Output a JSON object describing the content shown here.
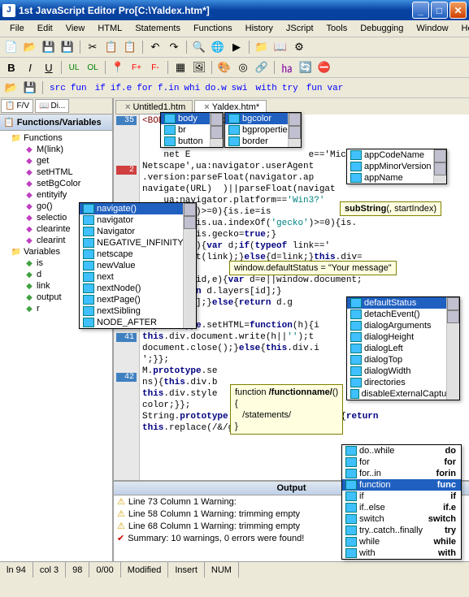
{
  "title": "1st JavaScript Editor Pro[C:\\Yaldex.htm*]",
  "menu": [
    "File",
    "Edit",
    "View",
    "HTML",
    "Statements",
    "Functions",
    "History",
    "JScript",
    "Tools",
    "Debugging",
    "Window",
    "Help"
  ],
  "toolbar3": {
    "items": [
      "src",
      "fun",
      "if",
      "if.e",
      "for",
      "f.in",
      "whi",
      "do.w",
      "swi",
      "with",
      "try",
      "fun",
      "var"
    ]
  },
  "sidebar": {
    "tabs": [
      "F/V",
      "Di..."
    ],
    "title": "Functions/Variables",
    "nodes": {
      "functions": "Functions",
      "fn_items": [
        "M(link)",
        "get",
        "setHTML",
        "setBgColor",
        "entityify",
        "go()",
        "selectio",
        "clearinte",
        "clearint"
      ],
      "variables": "Variables",
      "var_items": [
        "is",
        "d",
        "link",
        "output",
        "r"
      ]
    }
  },
  "editor": {
    "tabs": [
      {
        "label": "Untitled1.htm",
        "active": false
      },
      {
        "label": "Yaldex.htm*",
        "active": true
      }
    ],
    "first_line_no": "35",
    "code_lines": [
      "<BODY bgColor=linen>",
      "        IPT>",
      "    is={ie",
      "    net E                      e=='Microsoft",
      "Netscape',ua:navigator.userAgent",
      ".version:parseFloat(navigator.ap",
      "navigate(URL)  )||parseFloat(navigat",
      "    ua:navigator.platform=='Win3?'",
      "    opera')>=0){is.ie=is",
      "    e;}if(is.ua.indexOf('gecko')>=0){is.",
      "    false;is.gecko=true;}",
      "    M(link){var d;if(typeof link=='",
      "    d=M.get(link);}else{d=link;}this.div=",
      "",
      "    ction(id,e){var d=e||window.document;",
      "    {return d.layers[id];}",
      "    all[id];}else{return d.g",
      "",
      "M.prototype.setHTML=function(h){i",
      "this.div.document.write(h||'');t",
      "document.close();}else{this.div.i",
      "';}};",
      "M.prototype.se",
      "ns){this.div.b",
      "this.div.style         s=color||this.",
      "color;}};",
      "String.prototype.entityify=function(){return",
      "this.replace(/&/g,'&amp;').r"
    ],
    "gutter": [
      "35",
      "",
      "",
      "",
      "",
      "2",
      "",
      "",
      "",
      "",
      "",
      "",
      "",
      "",
      "",
      "",
      "",
      "",
      "40",
      "",
      "",
      "",
      "41",
      "",
      "",
      "",
      "42",
      ""
    ]
  },
  "popups": {
    "p1": {
      "items": [
        "body",
        "br",
        "button"
      ],
      "sel_index": 0
    },
    "p2": {
      "items": [
        "bgcolor",
        "bgproperties",
        "border"
      ],
      "sel_index": 0
    },
    "p3": {
      "items": [
        "appCodeName",
        "appMinorVersion",
        "appName"
      ],
      "sel_index": -1
    },
    "p4": {
      "items": [
        "navigate()",
        "navigator",
        "Navigator",
        "NEGATIVE_INFINITY",
        "netscape",
        "newValue",
        "next",
        "nextNode()",
        "nextPage()",
        "nextSibling",
        "NODE_AFTER"
      ],
      "sel_index": 0
    },
    "p5": {
      "items": [
        "defaultStatus",
        "detachEvent()",
        "dialogArguments",
        "dialogHeight",
        "dialogLeft",
        "dialogTop",
        "dialogWidth",
        "directories",
        "disableExternalCapture"
      ],
      "sel_index": 0
    },
    "p6": {
      "left": [
        "do..while",
        "for",
        "for..in",
        "function",
        "if",
        "if..else",
        "switch",
        "try..catch..finally",
        "while",
        "with"
      ],
      "right": [
        "do",
        "for",
        "forin",
        "func",
        "if",
        "if.e",
        "switch",
        "try",
        "while",
        "with"
      ],
      "sel_index": 3
    }
  },
  "tooltips": {
    "t1": {
      "text": "subString",
      "param": "(, startIndex)"
    },
    "t2": "window.defaultStatus = \"Your message\"",
    "t3_a": "function ",
    "t3_b": "/functionname/",
    "t3_c": "()",
    "t3_d": "/statements/"
  },
  "output": {
    "title": "Output",
    "rows": [
      {
        "icon": "warn",
        "text": "Line 73 Column 1  Warning: <script> inserting \"typ"
      },
      {
        "icon": "warn",
        "text": "Line 58 Column 1  Warning: trimming empty <p>"
      },
      {
        "icon": "warn",
        "text": "Line 68 Column 1  Warning: trimming empty <p>"
      },
      {
        "icon": "ok",
        "text": "Summary: 10 warnings, 0 errors were found!"
      }
    ]
  },
  "status": {
    "ln": "ln 94",
    "col": "col 3",
    "c3": "98",
    "c4": "0/00",
    "mod": "Modified",
    "ins": "Insert",
    "num": "NUM"
  }
}
